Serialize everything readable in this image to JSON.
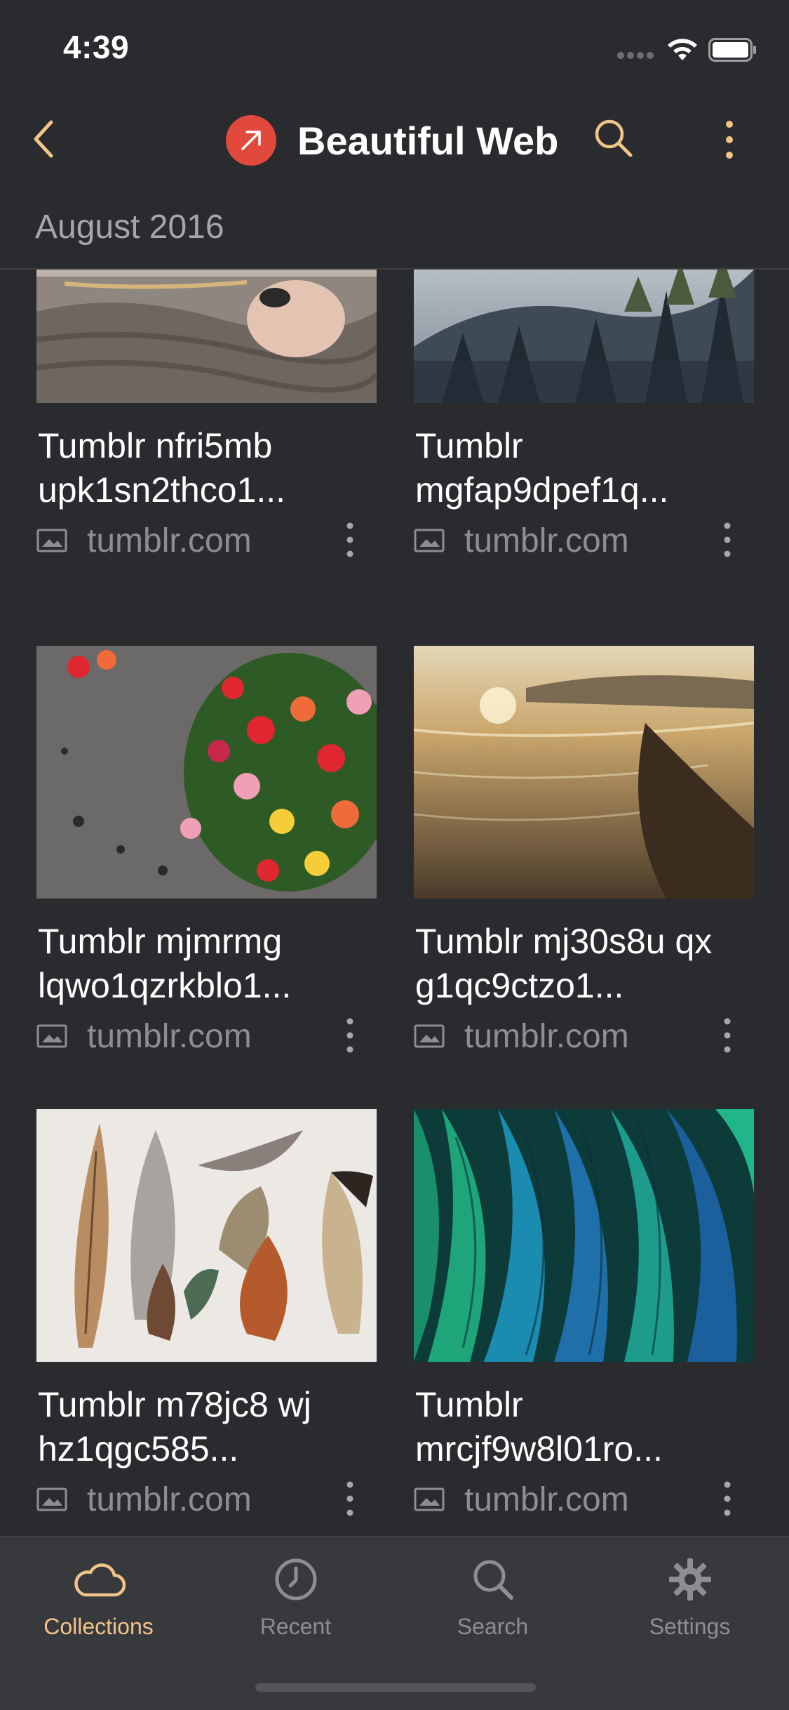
{
  "status_bar": {
    "time": "4:39"
  },
  "navbar": {
    "title": "Beautiful Web",
    "accent_color": "#e0493c",
    "icon_color": "#f2c488"
  },
  "section": {
    "title": "August 2016"
  },
  "cards": [
    {
      "title": "Tumblr nfri5mb upk1sn2thco1...",
      "domain": "tumblr.com",
      "image": "knit-sweater-hands"
    },
    {
      "title": "Tumblr mgfap9dpef1q...",
      "domain": "tumblr.com",
      "image": "foggy-forest-hills"
    },
    {
      "title": "Tumblr mjmrmg lqwo1qzrkblo1...",
      "domain": "tumblr.com",
      "image": "tulip-bouquet"
    },
    {
      "title": "Tumblr mj30s8u qx g1qc9ctzo1...",
      "domain": "tumblr.com",
      "image": "sunset-beach"
    },
    {
      "title": "Tumblr m78jc8 wj hz1qgc585...",
      "domain": "tumblr.com",
      "image": "assorted-feathers"
    },
    {
      "title": "Tumblr mrcjf9w8l01ro...",
      "domain": "tumblr.com",
      "image": "green-blue-feathers"
    }
  ],
  "tabs": [
    {
      "label": "Collections",
      "icon": "cloud-icon",
      "active": true
    },
    {
      "label": "Recent",
      "icon": "clock-icon",
      "active": false
    },
    {
      "label": "Search",
      "icon": "search-icon",
      "active": false
    },
    {
      "label": "Settings",
      "icon": "gear-icon",
      "active": false
    }
  ]
}
